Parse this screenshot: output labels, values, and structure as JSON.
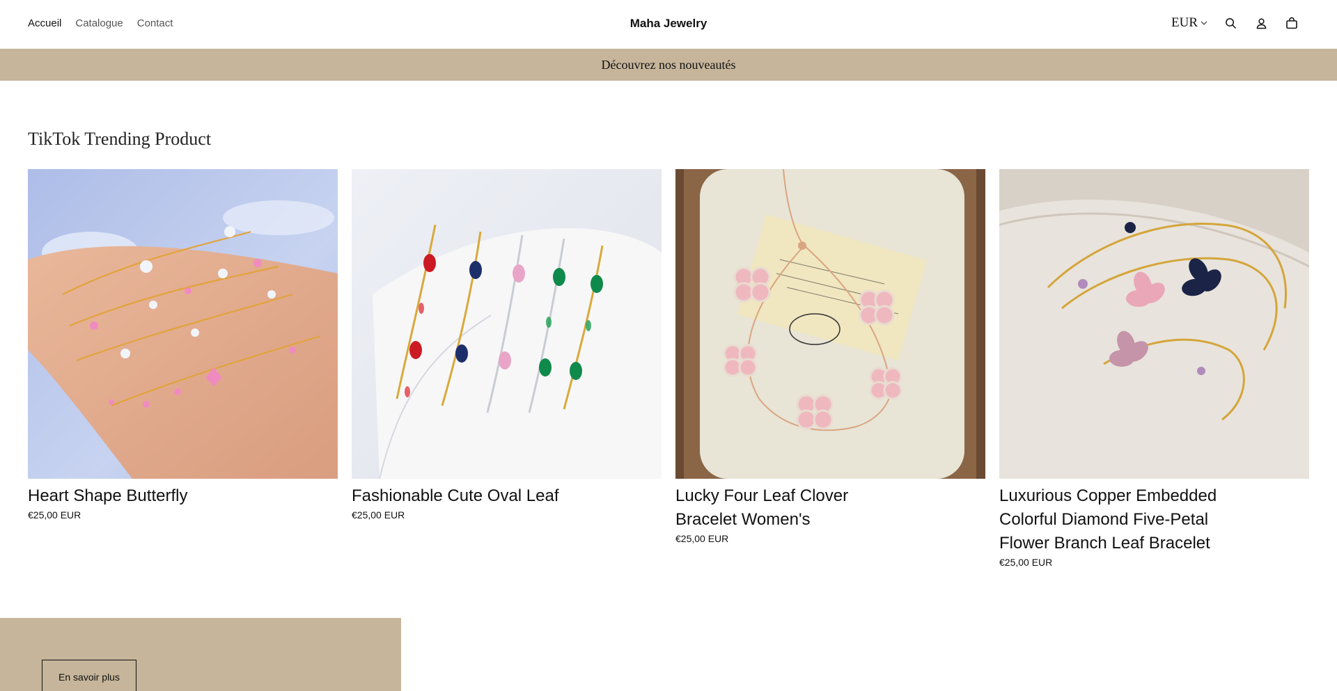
{
  "header": {
    "nav": [
      {
        "label": "Accueil",
        "active": true
      },
      {
        "label": "Catalogue",
        "active": false
      },
      {
        "label": "Contact",
        "active": false
      }
    ],
    "brand": "Maha Jewelry",
    "currency": "EUR",
    "icons": [
      "chevron-down-icon",
      "search-icon",
      "account-icon",
      "cart-icon"
    ]
  },
  "announcement": "Découvrez nos nouveautés",
  "section": {
    "title": "TikTok Trending Product",
    "products": [
      {
        "title": "Heart Shape Butterfly",
        "price": "€25,00 EUR"
      },
      {
        "title": "Fashionable Cute Oval Leaf",
        "price": "€25,00 EUR"
      },
      {
        "title": "Lucky Four Leaf Clover Bracelet Women's",
        "price": "€25,00 EUR"
      },
      {
        "title": "Luxurious Copper Embedded Colorful Diamond Five-Petal Flower Branch Leaf Bracelet",
        "price": "€25,00 EUR"
      }
    ]
  },
  "banner": {
    "button_label": "En savoir plus"
  },
  "colors": {
    "accent": "#c6b59a"
  }
}
